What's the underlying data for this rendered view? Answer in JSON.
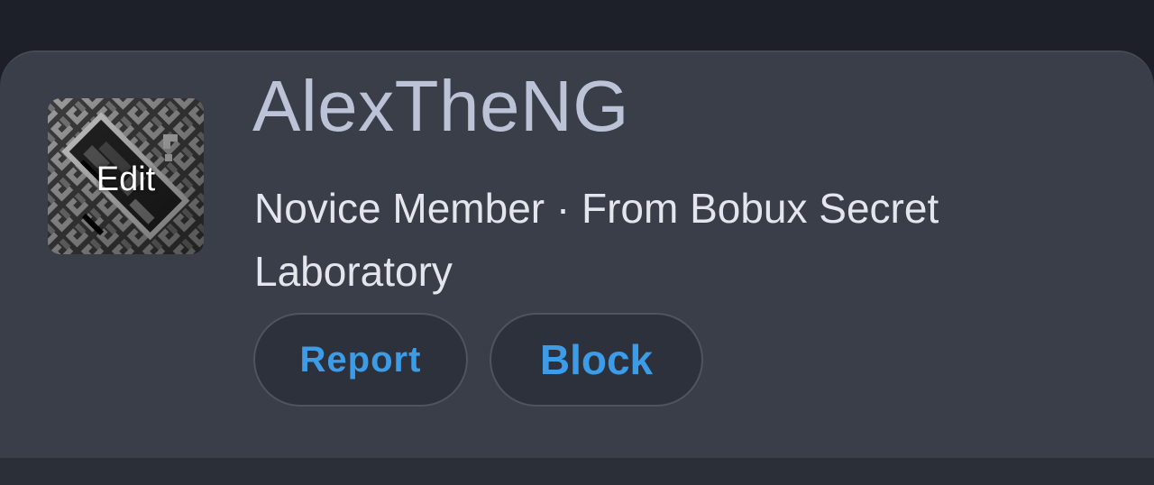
{
  "profile": {
    "username": "AlexTheNG",
    "rank": "Novice Member",
    "separator": "·",
    "location": "From Bobux Secret Laboratory",
    "avatar_overlay": "Edit",
    "avatar_icon": "pixel-avatar-image"
  },
  "actions": {
    "report_label": "Report",
    "block_label": "Block"
  },
  "colors": {
    "accent": "#3d9ce8",
    "card_background": "#393e48",
    "page_background": "#1c1f27",
    "username_text": "#bcc3d7",
    "subtitle_text": "#e3e6ec"
  }
}
